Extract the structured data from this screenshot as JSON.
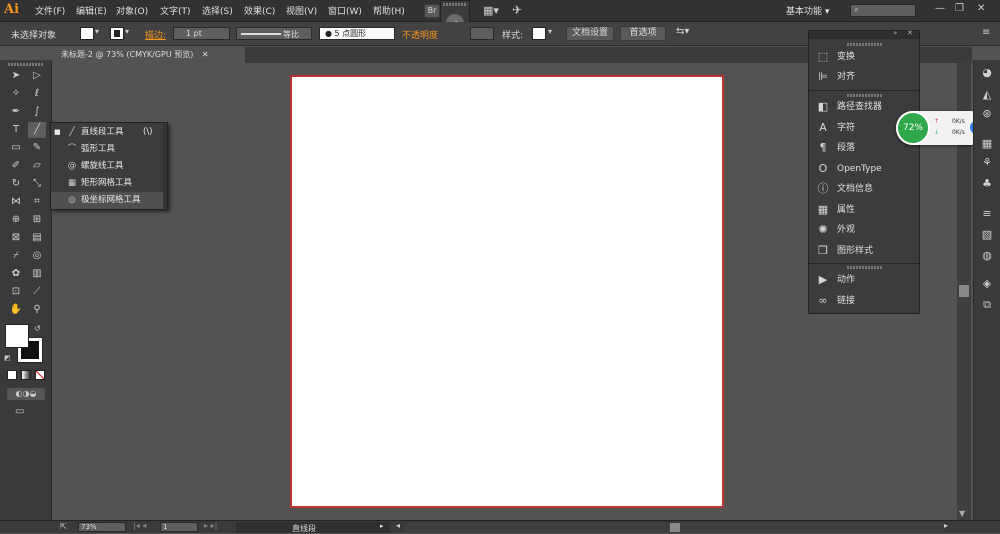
{
  "app": {
    "logo": "Ai"
  },
  "menu": [
    "文件(F)",
    "编辑(E)",
    "对象(O)",
    "文字(T)",
    "选择(S)",
    "效果(C)",
    "视图(V)",
    "窗口(W)",
    "帮助(H)"
  ],
  "menubar_right": {
    "bridge_label": "Br",
    "workspace": "基本功能",
    "search_placeholder": "",
    "minimize": "—",
    "restore": "❐",
    "close": "✕"
  },
  "control_bar": {
    "selection_status": "未选择对象",
    "stroke_label": "描边",
    "stroke_weight": "1 pt",
    "stroke_profile": "等比",
    "brush_label": "5 点圆形",
    "opacity_label": "不透明度",
    "style_label": "样式",
    "doc_setup_button": "文档设置",
    "preferences_button": "首选项"
  },
  "document_tab": {
    "title": "未标题-2 @ 73% (CMYK/GPU 预览)",
    "close": "✕"
  },
  "flyout": {
    "items": [
      {
        "label": "直线段工具",
        "shortcut": "(\\)",
        "icon": "line-segment-icon"
      },
      {
        "label": "弧形工具",
        "icon": "arc-icon"
      },
      {
        "label": "螺旋线工具",
        "icon": "spiral-icon"
      },
      {
        "label": "矩形网格工具",
        "icon": "rectangular-grid-icon"
      },
      {
        "label": "极坐标网格工具",
        "icon": "polar-grid-icon"
      }
    ]
  },
  "panel": {
    "items": [
      {
        "label": "变换",
        "icon": "transform-icon",
        "glyph": "⬚"
      },
      {
        "label": "对齐",
        "icon": "align-icon",
        "glyph": "⊫"
      },
      {
        "label": "路径查找器",
        "icon": "pathfinder-icon",
        "glyph": "◧"
      },
      {
        "label": "字符",
        "icon": "character-icon",
        "glyph": "A"
      },
      {
        "label": "段落",
        "icon": "paragraph-icon",
        "glyph": "¶"
      },
      {
        "label": "OpenType",
        "icon": "opentype-icon",
        "glyph": "O"
      },
      {
        "label": "文档信息",
        "icon": "document-info-icon",
        "glyph": "ⓘ"
      },
      {
        "label": "属性",
        "icon": "attributes-icon",
        "glyph": "▦"
      },
      {
        "label": "外观",
        "icon": "appearance-icon",
        "glyph": "✺"
      },
      {
        "label": "图形样式",
        "icon": "graphic-styles-icon",
        "glyph": "❒"
      },
      {
        "label": "动作",
        "icon": "actions-icon",
        "glyph": "▶"
      },
      {
        "label": "链接",
        "icon": "links-icon",
        "glyph": "∞"
      }
    ]
  },
  "network_widget": {
    "percent": "72%",
    "up": "0K/s",
    "down": "0K/s",
    "plus": "+"
  },
  "status_bar": {
    "zoom": "73%",
    "page": "1",
    "tool_name": "直线段"
  },
  "colors": {
    "accent_orange": "#f7931e",
    "artboard_border": "#b33",
    "widget_green": "#2ea84a"
  }
}
